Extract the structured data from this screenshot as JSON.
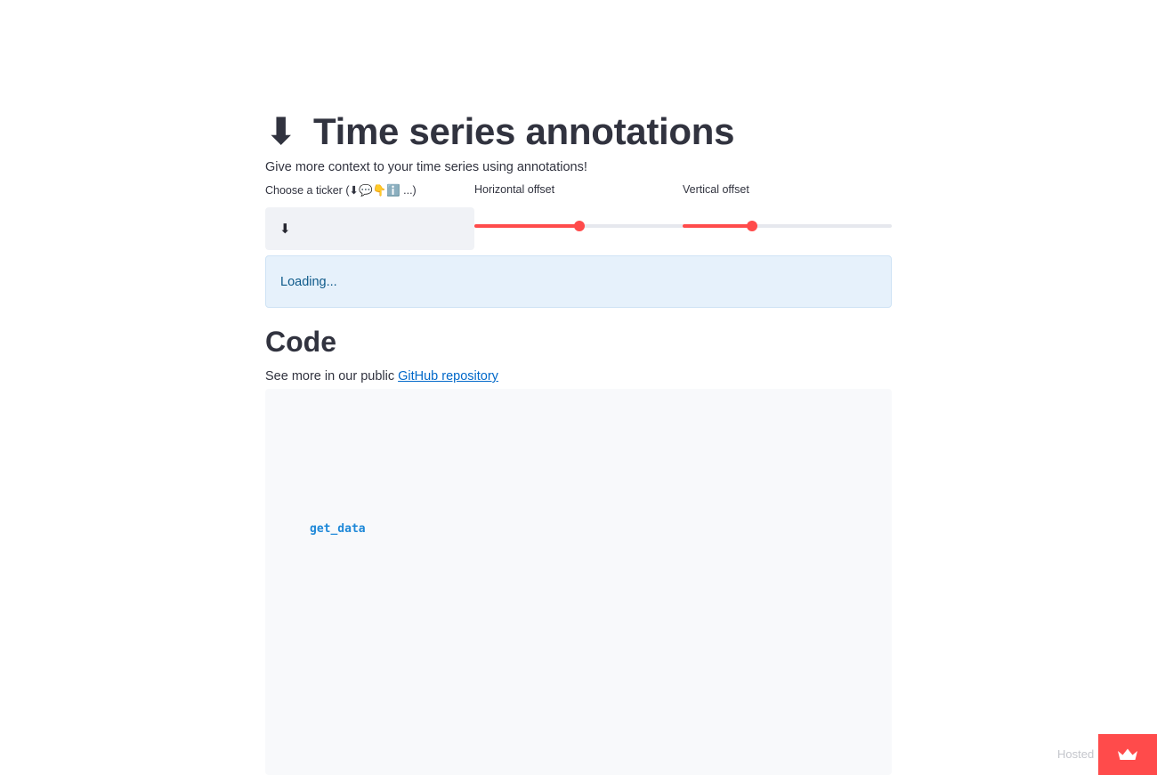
{
  "app": {
    "title_icon": "⬇",
    "title": "Time series annotations",
    "subtitle": "Give more context to your time series using annotations!"
  },
  "controls": {
    "ticker": {
      "label": "Choose a ticker (⬇💬👇ℹ️ ...)",
      "selected": "⬇"
    },
    "horizontal_offset": {
      "label": "Horizontal offset",
      "value_fraction": 0.5
    },
    "vertical_offset": {
      "label": "Vertical offset",
      "value_fraction": 0.33
    }
  },
  "status": {
    "text": "Loading..."
  },
  "code_section": {
    "heading": "Code",
    "intro_text": "See more in our public ",
    "link_text": "GitHub repository",
    "code_token": "get_data"
  },
  "footer": {
    "hosted_text": "Hosted",
    "badge_icon": "crown-icon"
  },
  "colors": {
    "accent": "#ff4b4b",
    "info_bg": "#e6f1fb",
    "info_text": "#0e5a8a",
    "link": "#0068c9",
    "code_bg": "#f8f9fb"
  }
}
